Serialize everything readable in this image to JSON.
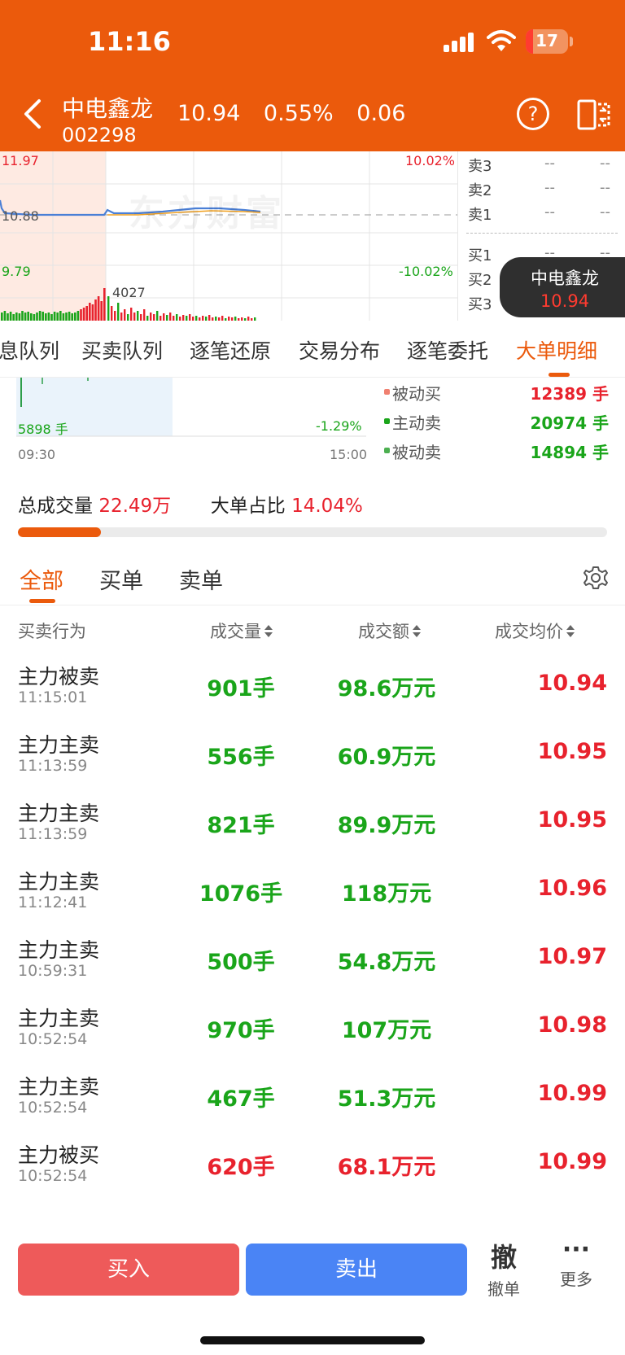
{
  "status": {
    "time": "11:16",
    "battery": "17",
    "battery_level_pct": 17
  },
  "header": {
    "stock_name": "中电鑫龙",
    "stock_code": "002298",
    "price": "10.94",
    "change_pct": "0.55%",
    "change": "0.06",
    "help": "?"
  },
  "mini_chart": {
    "high": "11.97",
    "mid": "10.88",
    "low": "9.79",
    "up_pct": "10.02%",
    "down_pct": "-10.02%",
    "vol_peak": "4027",
    "watermark": "东方财富"
  },
  "order_book": [
    {
      "label": "卖3",
      "price": "--",
      "vol": "--"
    },
    {
      "label": "卖2",
      "price": "--",
      "vol": "--"
    },
    {
      "label": "卖1",
      "price": "--",
      "vol": "--"
    },
    {
      "label": "买1",
      "price": "--",
      "vol": "--"
    },
    {
      "label": "买2",
      "price": "--",
      "vol": "--"
    },
    {
      "label": "买3",
      "price": "--",
      "vol": "--"
    }
  ],
  "stock_tag": {
    "name": "中电鑫龙",
    "price": "10.94"
  },
  "sub_tabs": [
    "息队列",
    "买卖队列",
    "逐笔还原",
    "交易分布",
    "逐笔委托",
    "大单明细"
  ],
  "intraday": {
    "vol": "5898 手",
    "pct": "-1.29%",
    "start": "09:30",
    "end": "15:00"
  },
  "legend": [
    {
      "name": "被动买",
      "value": "12389 手",
      "color": "#f08070"
    },
    {
      "name": "主动卖",
      "value": "20974 手",
      "color": "#1aa51a"
    },
    {
      "name": "被动卖",
      "value": "14894 手",
      "color": "#4caf50"
    }
  ],
  "totals": {
    "vol_label": "总成交量",
    "vol_value": "22.49万",
    "ratio_label": "大单占比",
    "ratio_value": "14.04%",
    "ratio_pct": 14.04
  },
  "filter_tabs": [
    "全部",
    "买单",
    "卖单"
  ],
  "table": {
    "headers": [
      "买卖行为",
      "成交量",
      "成交额",
      "成交均价"
    ],
    "rows": [
      {
        "action": "主力被卖",
        "time": "11:15:01",
        "vol": "901手",
        "amount": "98.6万元",
        "price": "10.94",
        "side": "sell"
      },
      {
        "action": "主力主卖",
        "time": "11:13:59",
        "vol": "556手",
        "amount": "60.9万元",
        "price": "10.95",
        "side": "sell"
      },
      {
        "action": "主力主卖",
        "time": "11:13:59",
        "vol": "821手",
        "amount": "89.9万元",
        "price": "10.95",
        "side": "sell"
      },
      {
        "action": "主力主卖",
        "time": "11:12:41",
        "vol": "1076手",
        "amount": "118万元",
        "price": "10.96",
        "side": "sell"
      },
      {
        "action": "主力主卖",
        "time": "10:59:31",
        "vol": "500手",
        "amount": "54.8万元",
        "price": "10.97",
        "side": "sell"
      },
      {
        "action": "主力主卖",
        "time": "10:52:54",
        "vol": "970手",
        "amount": "107万元",
        "price": "10.98",
        "side": "sell"
      },
      {
        "action": "主力主卖",
        "time": "10:52:54",
        "vol": "467手",
        "amount": "51.3万元",
        "price": "10.99",
        "side": "sell"
      },
      {
        "action": "主力被买",
        "time": "10:52:54",
        "vol": "620手",
        "amount": "68.1万元",
        "price": "10.99",
        "side": "buy"
      }
    ]
  },
  "bottom": {
    "buy": "买入",
    "sell": "卖出",
    "cancel_icon": "撤",
    "cancel": "撤单",
    "more_icon": "···",
    "more": "更多"
  }
}
